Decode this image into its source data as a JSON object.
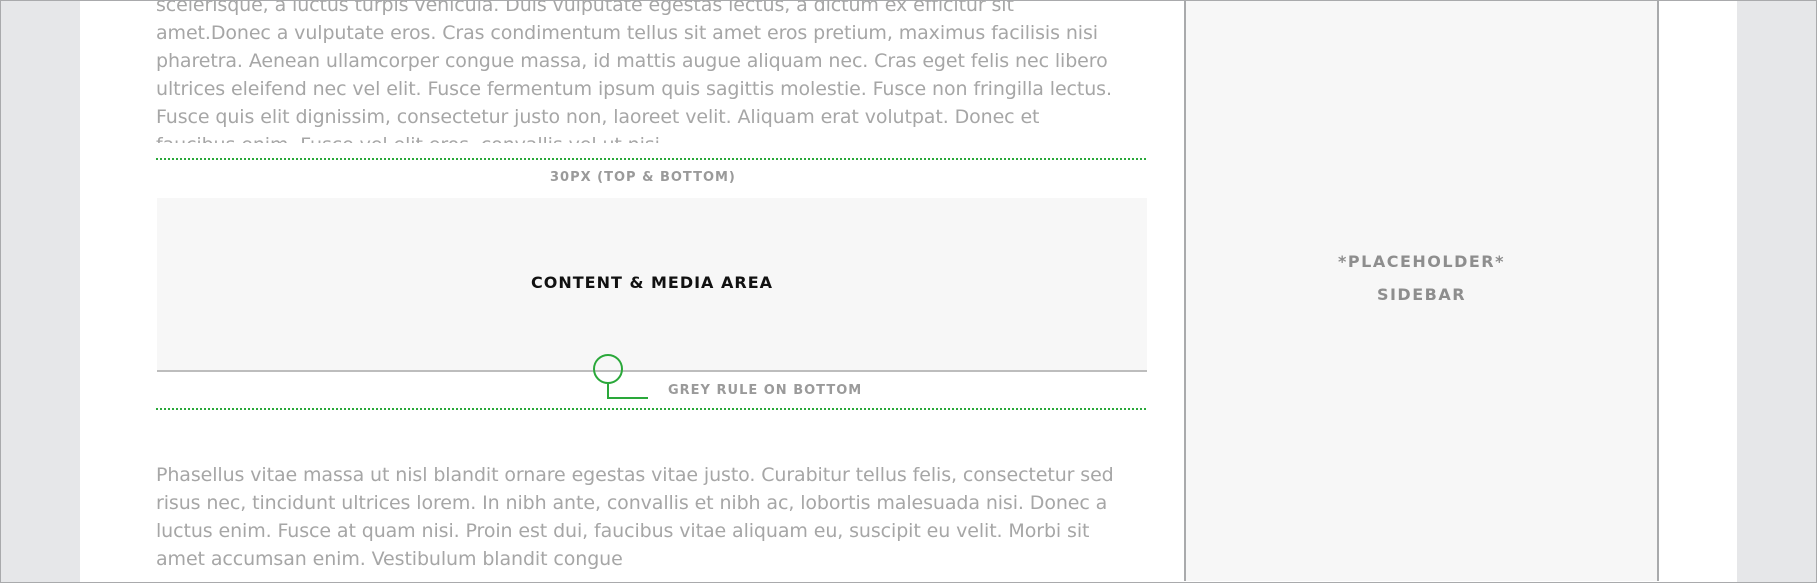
{
  "main": {
    "top_paragraph": "scelerisque, a luctus turpis vehicula. Duis vulputate egestas lectus, a dictum ex efficitur sit amet.Donec a vulputate eros. Cras condimentum tellus sit amet eros pretium, maximus facilisis nisi pharetra. Aenean ullamcorper congue massa, id mattis augue aliquam nec. Cras eget felis nec libero ultrices eleifend nec vel elit. Fusce fermentum ipsum quis sagittis molestie. Fusce non fringilla lectus. Fusce quis elit dignissim, consectetur justo non, laoreet velit. Aliquam erat volutpat. Donec et faucibus enim. Fusce vel elit eros, convallis vel ut nisi.",
    "spacing_label": "30PX (TOP & BOTTOM)",
    "content_area_label": "CONTENT & MEDIA AREA",
    "rule_label": "GREY RULE ON BOTTOM",
    "bottom_paragraph": "Phasellus vitae massa ut nisl blandit ornare egestas vitae justo. Curabitur tellus felis, consectetur sed risus nec, tincidunt ultrices lorem. In nibh ante, convallis et nibh ac, lobortis malesuada nisi. Donec a luctus enim. Fusce at quam nisi. Proin est dui, faucibus vitae aliquam eu, suscipit eu velit. Morbi sit amet accumsan enim. Vestibulum blandit congue"
  },
  "sidebar": {
    "line1": "*PLACEHOLDER*",
    "line2": "SIDEBAR"
  },
  "colors": {
    "annotation_green": "#2aa83a",
    "rule_grey": "#bdbdbd",
    "body_text": "#a6a6a6"
  }
}
